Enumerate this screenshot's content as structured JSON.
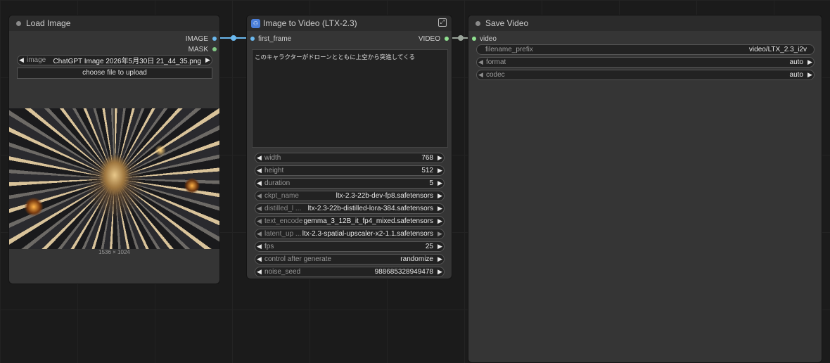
{
  "colors": {
    "image_port": "#6ab8ee",
    "mask_port": "#81c784",
    "video_port": "#8fe08f",
    "link_image": "#6ab8ee",
    "link_video": "#9aa49a"
  },
  "load_image": {
    "title": "Load Image",
    "outputs": [
      "IMAGE",
      "MASK"
    ],
    "image_widget": {
      "label": "image",
      "value": "ChatGPT Image 2026年5月30日 21_44_35.png"
    },
    "upload_button": "choose file to upload",
    "dimensions": "1536 × 1024"
  },
  "i2v": {
    "title": "Image to Video (LTX-2.3)",
    "input": "first_frame",
    "output": "VIDEO",
    "prompt": "このキャラクターがドローンとともに上空から突進してくる",
    "widgets": [
      {
        "label": "width",
        "value": "768"
      },
      {
        "label": "height",
        "value": "512"
      },
      {
        "label": "duration",
        "value": "5"
      },
      {
        "label": "ckpt_name",
        "value": "ltx-2.3-22b-dev-fp8.safetensors"
      },
      {
        "label": "distilled_l ...",
        "value": "ltx-2.3-22b-distilled-lora-384.safetensors"
      },
      {
        "label": "text_encoder",
        "value": "gemma_3_12B_it_fp4_mixed.safetensors"
      },
      {
        "label": "latent_up ...",
        "value": "ltx-2.3-spatial-upscaler-x2-1.1.safetensors"
      },
      {
        "label": "fps",
        "value": "25"
      },
      {
        "label": "control after generate",
        "value": "randomize"
      },
      {
        "label": "noise_seed",
        "value": "988685328949478"
      }
    ]
  },
  "save_video": {
    "title": "Save Video",
    "input": "video",
    "widgets": [
      {
        "label": "filename_prefix",
        "value": "video/LTX_2.3_i2v"
      },
      {
        "label": "format",
        "value": "auto"
      },
      {
        "label": "codec",
        "value": "auto"
      }
    ]
  }
}
